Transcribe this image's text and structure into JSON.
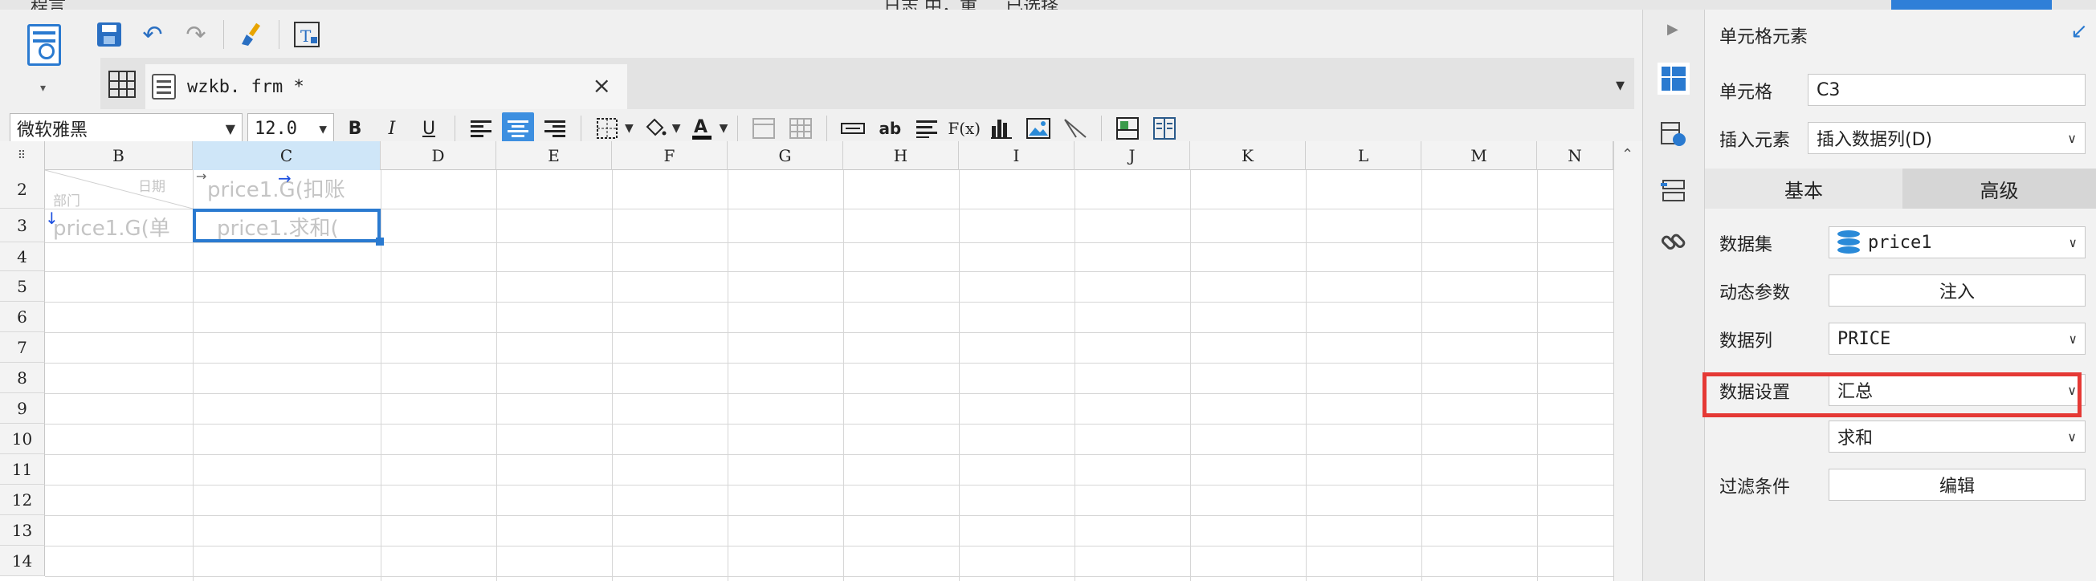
{
  "top_strip": {
    "left_text": "程言",
    "middle_text": "日志 中，重 ... 已选择 ...",
    "icons": [
      "search-icon",
      "user-icon"
    ]
  },
  "quick_toolbar": {
    "items": [
      {
        "name": "save",
        "icon": "save-icon"
      },
      {
        "name": "undo",
        "icon": "undo-icon",
        "glyph": "↶"
      },
      {
        "name": "redo",
        "icon": "redo-icon",
        "glyph": "↷"
      },
      {
        "name": "clear-format",
        "icon": "brush-icon",
        "glyph": "🖌"
      },
      {
        "name": "template",
        "icon": "text-template-icon",
        "glyph": "T"
      }
    ]
  },
  "tab": {
    "filename": "wzkb. frm *",
    "close": "×",
    "menu": "▾"
  },
  "format_toolbar": {
    "font_name": "微软雅黑",
    "font_size": "12.0",
    "bold": "B",
    "italic": "I",
    "underline": "U",
    "formula": "F(x)",
    "ab": "ab"
  },
  "sheet": {
    "columns": [
      "B",
      "C",
      "D",
      "E",
      "F",
      "G",
      "H",
      "I",
      "J",
      "K",
      "L",
      "M",
      "N"
    ],
    "selected_column": "C",
    "rows": [
      "2",
      "3",
      "4",
      "5",
      "6",
      "7",
      "8",
      "9",
      "10",
      "11",
      "12",
      "13",
      "14"
    ],
    "cells": {
      "b2_top": "日期",
      "b2_bottom": "部门",
      "c2": "price1.G(扣账",
      "b3": "price1.G(单",
      "c3": "price1.求和("
    }
  },
  "panel": {
    "title": "单元格元素",
    "cell_label": "单元格",
    "cell_value": "C3",
    "insert_label": "插入元素",
    "insert_value": "插入数据列(D)",
    "tab_basic": "基本",
    "tab_advanced": "高级",
    "dataset_label": "数据集",
    "dataset_value": "price1",
    "dynamic_param_label": "动态参数",
    "dynamic_param_button": "注入",
    "column_label": "数据列",
    "column_value": "PRICE",
    "data_setting_label": "数据设置",
    "data_setting_value": "汇总",
    "aggregate_value": "求和",
    "filter_label": "过滤条件",
    "filter_button": "编辑"
  },
  "colors": {
    "accent": "#2a7ad0",
    "highlight": "#e53935",
    "selected_header": "#cfe6f8"
  }
}
